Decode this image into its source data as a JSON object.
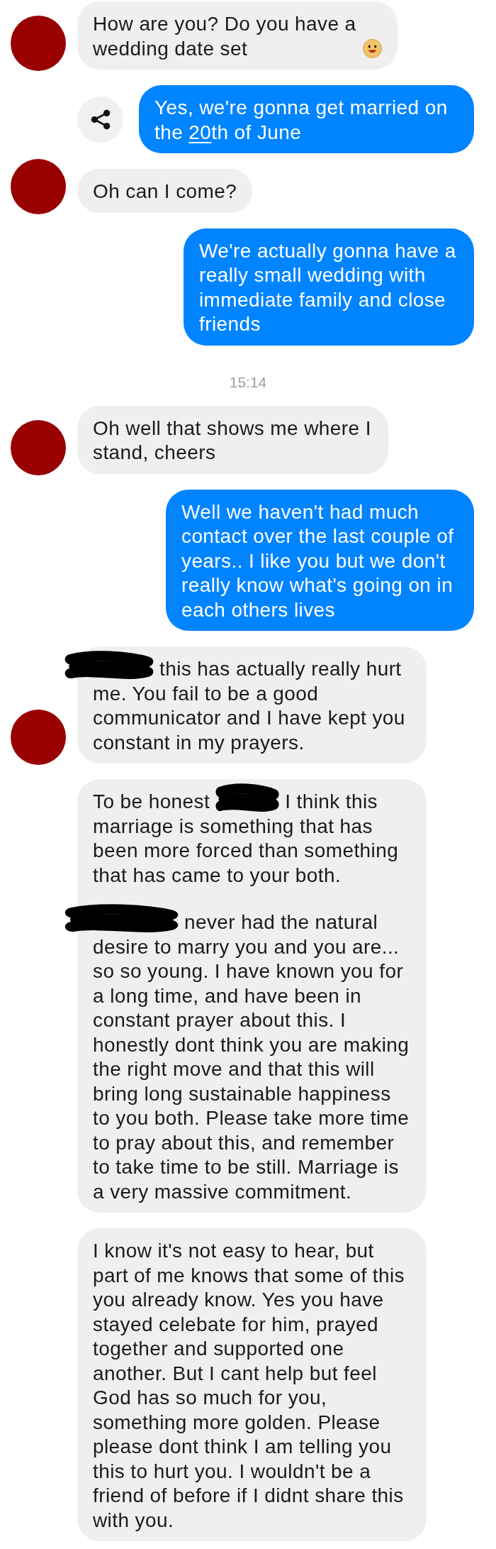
{
  "messages": [
    {
      "kind": "received",
      "avatar": true,
      "paragraphs": [
        [
          {
            "kind": "text",
            "text": "How are you? Do you have a wedding date set"
          },
          {
            "kind": "emoji"
          }
        ]
      ]
    },
    {
      "kind": "sent",
      "share_button": true,
      "paragraphs": [
        [
          {
            "kind": "text",
            "text": "Yes, we're gonna get married on the "
          },
          {
            "kind": "link",
            "text": "20"
          },
          {
            "kind": "text",
            "text": "th of June"
          }
        ]
      ]
    },
    {
      "kind": "received",
      "avatar": true,
      "paragraphs": [
        [
          {
            "kind": "text",
            "text": "Oh can I come?"
          }
        ]
      ]
    },
    {
      "kind": "sent",
      "share_button": false,
      "paragraphs": [
        [
          {
            "kind": "text",
            "text": "We're actually gonna have a really small wedding with immediate family and close friends"
          }
        ]
      ]
    },
    {
      "kind": "timestamp",
      "text": "15:14"
    },
    {
      "kind": "received",
      "avatar": true,
      "paragraphs": [
        [
          {
            "kind": "text",
            "text": "Oh well that shows me where I stand, cheers"
          }
        ]
      ]
    },
    {
      "kind": "sent",
      "share_button": false,
      "paragraphs": [
        [
          {
            "kind": "text",
            "text": "Well we haven't had much contact over the last couple of years.. I like you but we don't really know what's going on in each others lives"
          }
        ]
      ]
    },
    {
      "kind": "received",
      "avatar": true,
      "paragraphs": [
        [
          {
            "kind": "redacted"
          },
          {
            "kind": "text",
            "text": "this has actually really hurt"
          },
          {
            "kind": "text",
            "text": "me. You fail to be a good communicator and I have kept you constant in my prayers."
          }
        ]
      ]
    },
    {
      "kind": "received",
      "avatar": false,
      "paragraphs": [
        [
          {
            "kind": "text",
            "text": "To be honest"
          },
          {
            "kind": "redacted"
          },
          {
            "kind": "text",
            "text": "I think this"
          },
          {
            "kind": "text",
            "text": "marriage is something that has been more forced than something that has came to your both."
          }
        ],
        [
          {
            "kind": "redacted"
          },
          {
            "kind": "text",
            "text": "never had the natural"
          },
          {
            "kind": "text",
            "text": "desire to marry you and you are... so so young. I have known you for a long time, and have been in constant prayer about this. I honestly dont think you are making the right move and that this will bring long sustainable happiness to you both. Please take more time to pray about this, and remember to take time to be still. Marriage is a very massive commitment."
          }
        ]
      ]
    },
    {
      "kind": "received",
      "avatar": false,
      "paragraphs": [
        [
          {
            "kind": "text",
            "text": "I know it's not easy to hear, but part of me knows that some of this you already know. Yes you have stayed celebate for him, prayed together and supported one another. But I cant help but feel God has so much for you, something more golden. Please please dont think I am telling you this to hurt you. I wouldn't be a friend of before if I didnt share this with you."
          }
        ]
      ]
    }
  ]
}
